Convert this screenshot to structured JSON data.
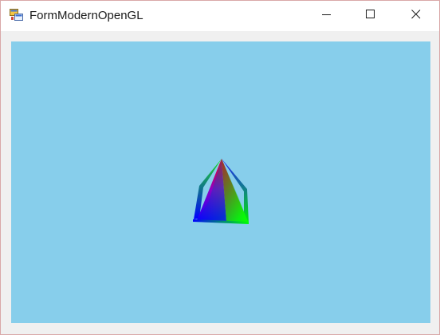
{
  "window": {
    "title": "FormModernOpenGL"
  },
  "titlebar": {
    "app_icon": "winforms-app-icon",
    "minimize_icon": "minimize-icon",
    "maximize_icon": "maximize-icon",
    "close_icon": "close-icon"
  },
  "viewport": {
    "background_color": "#87ceeb",
    "scene": "rotating-pyramid",
    "vertex_colors": [
      "#ff0000",
      "#00ff00",
      "#0000ff"
    ]
  }
}
